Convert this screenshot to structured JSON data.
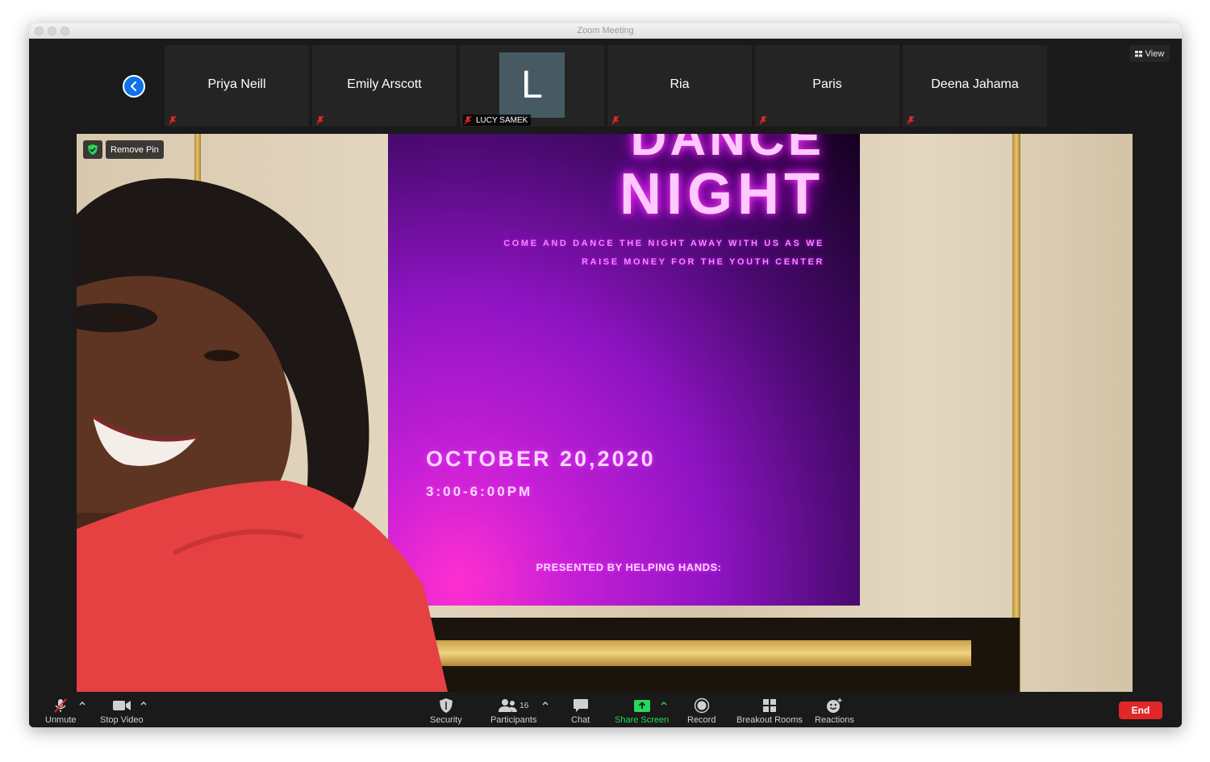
{
  "window": {
    "title": "Zoom Meeting"
  },
  "header": {
    "view_label": "View"
  },
  "participants_strip": [
    {
      "name": "Priya Neill",
      "muted": true
    },
    {
      "name": "Emily Arscott",
      "muted": true
    },
    {
      "name": "LUCY SAMEK",
      "avatar_letter": "L",
      "muted": true
    },
    {
      "name": "Ria",
      "muted": true
    },
    {
      "name": "Paris",
      "muted": true
    },
    {
      "name": "Deena Jahama",
      "muted": true
    }
  ],
  "pinned_video": {
    "remove_pin_label": "Remove Pin",
    "poster": {
      "line1": "DANCE",
      "line2": "NIGHT",
      "tagline1": "COME AND DANCE THE NIGHT AWAY WITH US AS WE",
      "tagline2": "RAISE MONEY FOR THE YOUTH CENTER",
      "date": "OCTOBER 20,2020",
      "time": "3:00-6:00PM",
      "presented_by": "PRESENTED BY HELPING HANDS:"
    }
  },
  "toolbar": {
    "unmute": "Unmute",
    "stop_video": "Stop Video",
    "security": "Security",
    "participants": "Participants",
    "participants_count": "16",
    "chat": "Chat",
    "share_screen": "Share Screen",
    "record": "Record",
    "breakout_rooms": "Breakout Rooms",
    "reactions": "Reactions",
    "end": "End"
  },
  "colors": {
    "accent_blue": "#0e72ed",
    "share_green": "#23d959",
    "end_red": "#e02828",
    "muted_red": "#e02828"
  }
}
